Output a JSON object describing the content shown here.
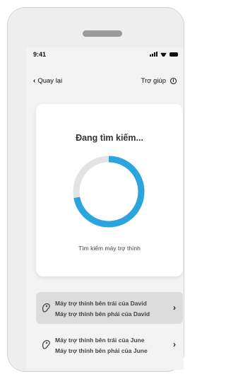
{
  "status_bar": {
    "time": "9:41"
  },
  "nav": {
    "back_label": "Quay lại",
    "help_label": "Trợ giúp"
  },
  "search_card": {
    "title": "Đang tìm kiếm...",
    "subtitle": "Tìm kiếm máy trợ thính",
    "progress": 0.72,
    "progress_color": "#2ba5de",
    "track_color": "#e3e3e3"
  },
  "devices": [
    {
      "left": "Máy trợ thính bên trái của David",
      "right": "Máy trợ thính bên phải của David",
      "selected": true
    },
    {
      "left": "Máy trợ thính bên trái của June",
      "right": "Máy trợ thính bên phải của June",
      "selected": false
    }
  ]
}
